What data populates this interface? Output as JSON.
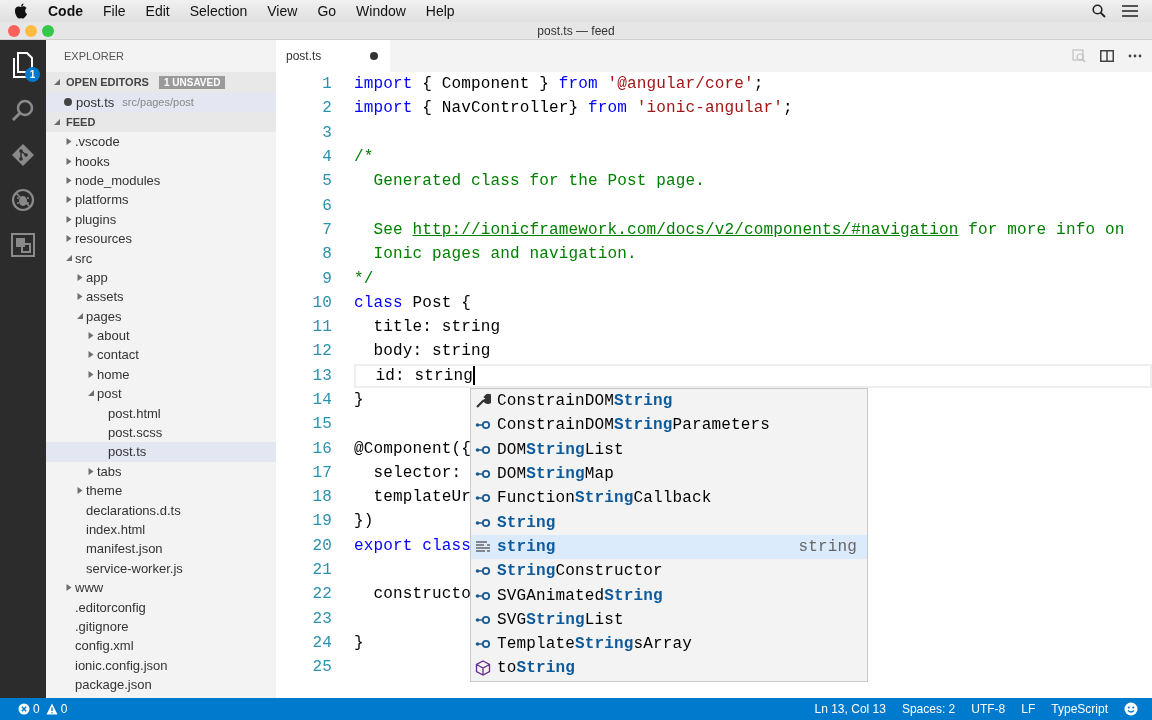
{
  "menu_bar": {
    "app": "Code",
    "items": [
      "File",
      "Edit",
      "Selection",
      "View",
      "Go",
      "Window",
      "Help"
    ]
  },
  "window": {
    "title": "post.ts — feed"
  },
  "activity_bar": {
    "items": [
      {
        "kind": "files",
        "selected": true,
        "badge": "1"
      },
      {
        "kind": "search",
        "selected": false
      },
      {
        "kind": "git",
        "selected": false
      },
      {
        "kind": "debug",
        "selected": false
      },
      {
        "kind": "extensions",
        "selected": false
      }
    ]
  },
  "sidebar": {
    "title": "EXPLORER",
    "open_editors": {
      "label": "OPEN EDITORS",
      "expanded": true,
      "badge": "1 UNSAVED",
      "items": [
        {
          "name": "post.ts",
          "path": "src/pages/post",
          "dirty": true,
          "selected": true
        }
      ]
    },
    "folder": {
      "label": "FEED",
      "expanded": true,
      "children": [
        {
          "name": ".vscode",
          "kind": "folder",
          "expanded": false,
          "selected": false
        },
        {
          "name": "hooks",
          "kind": "folder",
          "expanded": false,
          "selected": false
        },
        {
          "name": "node_modules",
          "kind": "folder",
          "expanded": false,
          "selected": false
        },
        {
          "name": "platforms",
          "kind": "folder",
          "expanded": false,
          "selected": false
        },
        {
          "name": "plugins",
          "kind": "folder",
          "expanded": false,
          "selected": false
        },
        {
          "name": "resources",
          "kind": "folder",
          "expanded": false,
          "selected": false
        },
        {
          "name": "src",
          "kind": "folder",
          "expanded": true,
          "selected": false,
          "children": [
            {
              "name": "app",
              "kind": "folder",
              "expanded": false,
              "selected": false
            },
            {
              "name": "assets",
              "kind": "folder",
              "expanded": false,
              "selected": false
            },
            {
              "name": "pages",
              "kind": "folder",
              "expanded": true,
              "selected": false,
              "children": [
                {
                  "name": "about",
                  "kind": "folder",
                  "expanded": false,
                  "selected": false
                },
                {
                  "name": "contact",
                  "kind": "folder",
                  "expanded": false,
                  "selected": false
                },
                {
                  "name": "home",
                  "kind": "folder",
                  "expanded": false,
                  "selected": false
                },
                {
                  "name": "post",
                  "kind": "folder",
                  "expanded": true,
                  "selected": false,
                  "children": [
                    {
                      "name": "post.html",
                      "kind": "file",
                      "selected": false
                    },
                    {
                      "name": "post.scss",
                      "kind": "file",
                      "selected": false
                    },
                    {
                      "name": "post.ts",
                      "kind": "file",
                      "selected": true
                    }
                  ]
                },
                {
                  "name": "tabs",
                  "kind": "folder",
                  "expanded": false,
                  "selected": false
                }
              ]
            },
            {
              "name": "theme",
              "kind": "folder",
              "expanded": false,
              "selected": false
            },
            {
              "name": "declarations.d.ts",
              "kind": "file",
              "selected": false
            },
            {
              "name": "index.html",
              "kind": "file",
              "selected": false
            },
            {
              "name": "manifest.json",
              "kind": "file",
              "selected": false
            },
            {
              "name": "service-worker.js",
              "kind": "file",
              "selected": false
            }
          ]
        },
        {
          "name": "www",
          "kind": "folder",
          "expanded": false,
          "selected": false
        },
        {
          "name": ".editorconfig",
          "kind": "file",
          "selected": false
        },
        {
          "name": ".gitignore",
          "kind": "file",
          "selected": false
        },
        {
          "name": "config.xml",
          "kind": "file",
          "selected": false
        },
        {
          "name": "ionic.config.json",
          "kind": "file",
          "selected": false
        },
        {
          "name": "package.json",
          "kind": "file",
          "selected": false
        }
      ]
    }
  },
  "editor": {
    "tabs": [
      {
        "label": "post.ts",
        "dirty": true,
        "selected": true
      }
    ],
    "lines": [
      {
        "number": "1",
        "tokens": [
          {
            "kind": "keyword",
            "text": "import"
          },
          {
            "kind": "plain",
            "text": " { Component } "
          },
          {
            "kind": "keyword",
            "text": "from"
          },
          {
            "kind": "string",
            "text": " '@angular/core'"
          },
          {
            "kind": "plain",
            "text": ";"
          }
        ]
      },
      {
        "number": "2",
        "tokens": [
          {
            "kind": "keyword",
            "text": "import"
          },
          {
            "kind": "plain",
            "text": " { NavController} "
          },
          {
            "kind": "keyword",
            "text": "from"
          },
          {
            "kind": "string",
            "text": " 'ionic-angular'"
          },
          {
            "kind": "plain",
            "text": ";"
          }
        ]
      },
      {
        "number": "3"
      },
      {
        "number": "4",
        "tokens": [
          {
            "kind": "comment",
            "text": "/*"
          }
        ]
      },
      {
        "number": "5",
        "tokens": [
          {
            "kind": "comment",
            "text": "  Generated class for the Post page."
          }
        ]
      },
      {
        "number": "6"
      },
      {
        "number": "7",
        "tokens": [
          {
            "kind": "comment",
            "text": "  See "
          },
          {
            "kind": "link",
            "text": "http://ionicframework.com/docs/v2/components/#navigation"
          },
          {
            "kind": "comment",
            "text": " for more info on"
          }
        ]
      },
      {
        "number": "8",
        "tokens": [
          {
            "kind": "comment",
            "text": "  Ionic pages and navigation."
          }
        ]
      },
      {
        "number": "9",
        "tokens": [
          {
            "kind": "comment",
            "text": "*/"
          }
        ]
      },
      {
        "number": "10",
        "tokens": [
          {
            "kind": "keyword",
            "text": "class"
          },
          {
            "kind": "plain",
            "text": " Post {"
          }
        ]
      },
      {
        "number": "11",
        "tokens": [
          {
            "kind": "plain",
            "text": "  title: string"
          }
        ]
      },
      {
        "number": "12",
        "tokens": [
          {
            "kind": "plain",
            "text": "  body: string"
          }
        ]
      },
      {
        "number": "13",
        "current": true,
        "tokens": [
          {
            "kind": "plain",
            "text": "  id: string"
          }
        ]
      },
      {
        "number": "14",
        "tokens": [
          {
            "kind": "plain",
            "text": "}"
          }
        ]
      },
      {
        "number": "15"
      },
      {
        "number": "16",
        "tokens": [
          {
            "kind": "plain",
            "text": "@Component({"
          }
        ]
      },
      {
        "number": "17",
        "tokens": [
          {
            "kind": "plain",
            "text": "  selector:"
          }
        ]
      },
      {
        "number": "18",
        "tokens": [
          {
            "kind": "plain",
            "text": "  templateUr"
          }
        ]
      },
      {
        "number": "19",
        "tokens": [
          {
            "kind": "plain",
            "text": "})"
          }
        ]
      },
      {
        "number": "20",
        "tokens": [
          {
            "kind": "keyword",
            "text": "export"
          },
          {
            "kind": "keyword",
            "text": " class"
          }
        ]
      },
      {
        "number": "21"
      },
      {
        "number": "22",
        "tokens": [
          {
            "kind": "plain",
            "text": "  constructo"
          }
        ]
      },
      {
        "number": "23"
      },
      {
        "number": "24",
        "tokens": [
          {
            "kind": "plain",
            "text": "}"
          }
        ]
      },
      {
        "number": "25"
      }
    ],
    "suggestions": [
      {
        "kind": "snippet",
        "label": "ConstrainDOM**String**",
        "selected": false
      },
      {
        "kind": "interface",
        "label": "ConstrainDOM**String**Parameters",
        "selected": false
      },
      {
        "kind": "interface",
        "label": "DOM**String**List",
        "selected": false
      },
      {
        "kind": "interface",
        "label": "DOM**String**Map",
        "selected": false
      },
      {
        "kind": "interface",
        "label": "Function**String**Callback",
        "selected": false
      },
      {
        "kind": "interface",
        "label": "**String**",
        "selected": false
      },
      {
        "kind": "keyword",
        "label": "**string**",
        "detail": "string",
        "selected": true
      },
      {
        "kind": "interface",
        "label": "**String**Constructor",
        "selected": false
      },
      {
        "kind": "interface",
        "label": "SVGAnimated**String**",
        "selected": false
      },
      {
        "kind": "interface",
        "label": "SVG**String**List",
        "selected": false
      },
      {
        "kind": "interface",
        "label": "Template**String**sArray",
        "selected": false
      },
      {
        "kind": "method",
        "label": "to**String**",
        "selected": false
      }
    ]
  },
  "status_bar": {
    "errors": "0",
    "warnings": "0",
    "items": [
      "Ln 13, Col 13",
      "Spaces: 2",
      "UTF-8",
      "LF",
      "TypeScript"
    ]
  }
}
